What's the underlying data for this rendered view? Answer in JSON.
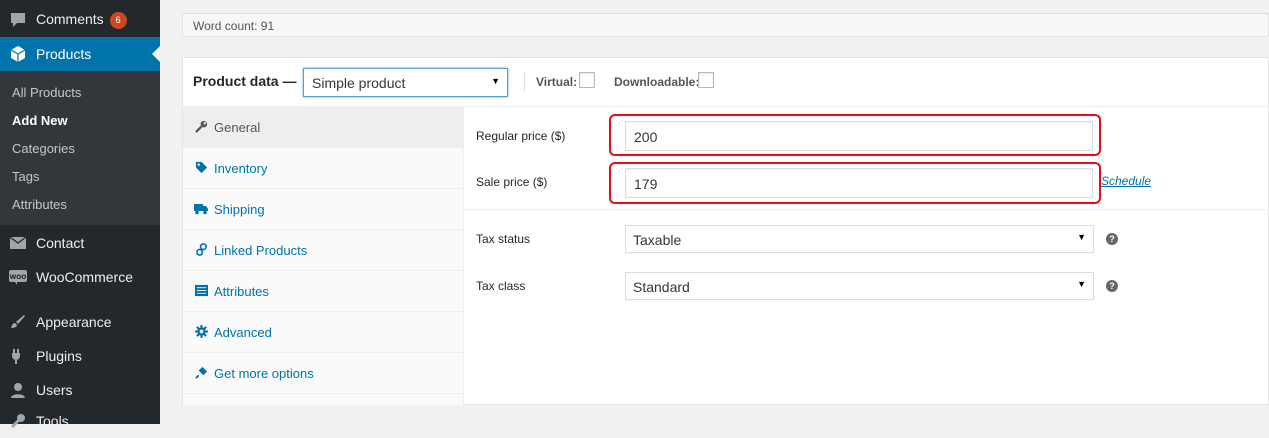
{
  "sidebar": {
    "comments": {
      "label": "Comments",
      "badge": "6"
    },
    "products": {
      "label": "Products"
    },
    "submenu": [
      {
        "label": "All Products"
      },
      {
        "label": "Add New"
      },
      {
        "label": "Categories"
      },
      {
        "label": "Tags"
      },
      {
        "label": "Attributes"
      }
    ],
    "contact": {
      "label": "Contact"
    },
    "woocommerce": {
      "label": "WooCommerce",
      "icon_text": "WOO"
    },
    "appearance": {
      "label": "Appearance"
    },
    "plugins": {
      "label": "Plugins"
    },
    "users": {
      "label": "Users"
    },
    "tools": {
      "label": "Tools"
    }
  },
  "editor": {
    "word_count": "Word count: 91"
  },
  "product_data": {
    "title": "Product data —",
    "type_select": {
      "value": "Simple product"
    },
    "virtual_label": "Virtual:",
    "downloadable_label": "Downloadable:",
    "tabs": [
      {
        "label": "General",
        "icon": "wrench-icon"
      },
      {
        "label": "Inventory",
        "icon": "tag-icon"
      },
      {
        "label": "Shipping",
        "icon": "truck-icon"
      },
      {
        "label": "Linked Products",
        "icon": "link-icon"
      },
      {
        "label": "Attributes",
        "icon": "list-icon"
      },
      {
        "label": "Advanced",
        "icon": "gear-icon"
      },
      {
        "label": "Get more options",
        "icon": "plug-icon"
      }
    ],
    "general": {
      "regular_price_label": "Regular price ($)",
      "regular_price_value": "200",
      "sale_price_label": "Sale price ($)",
      "sale_price_value": "179",
      "schedule_link": "Schedule",
      "tax_status_label": "Tax status",
      "tax_status_value": "Taxable",
      "tax_class_label": "Tax class",
      "tax_class_value": "Standard",
      "help_glyph": "?"
    }
  },
  "colors": {
    "sidebar_bg": "#23282d",
    "submenu_bg": "#32373c",
    "accent": "#0073aa",
    "badge": "#ca4a1f",
    "highlight": "#e0101a"
  }
}
